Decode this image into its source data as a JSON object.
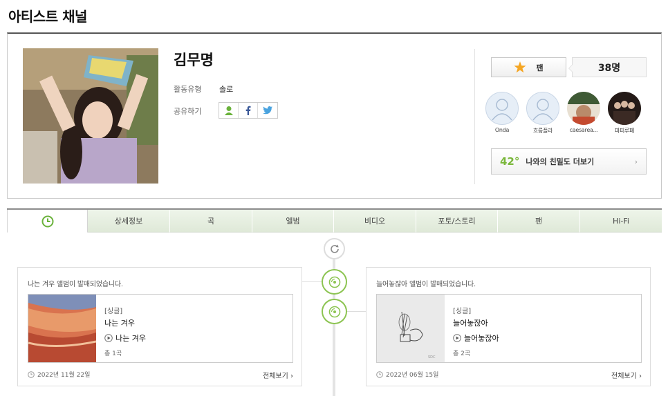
{
  "page": {
    "title": "아티스트 채널"
  },
  "artist": {
    "name": "김무명",
    "activity_type_label": "활동유형",
    "activity_type_value": "솔로",
    "share_label": "공유하기"
  },
  "fan": {
    "button_label": "팬",
    "count": "38명",
    "accent_color": "#f5a623",
    "fans": [
      {
        "name": "Onda",
        "avatar": "default-avatar-icon"
      },
      {
        "name": "흐름플라",
        "avatar": "default-avatar-icon"
      },
      {
        "name": "caesarea...",
        "avatar": "photo"
      },
      {
        "name": "파피루페",
        "avatar": "photo"
      }
    ],
    "intimacy_degree": "42°",
    "intimacy_label": "나와의 친밀도 더보기"
  },
  "tabs": [
    {
      "label": "",
      "icon": "clock-icon",
      "active": true
    },
    {
      "label": "상세정보"
    },
    {
      "label": "곡"
    },
    {
      "label": "앨범"
    },
    {
      "label": "비디오"
    },
    {
      "label": "포토/스토리"
    },
    {
      "label": "팬"
    },
    {
      "label": "Hi-Fi"
    }
  ],
  "timeline": {
    "accent_color": "#8cc451",
    "cards": [
      {
        "headline": "나는 겨우 앨범이 발매되었습니다.",
        "type": "[싱글]",
        "album_title": "나는 겨우",
        "track": "나는 겨우",
        "count": "총 1곡",
        "date": "2022년 11월 22일",
        "more": "전체보기 ›"
      },
      {
        "headline": "늘어놓잖아 앨범이 발매되었습니다.",
        "type": "[싱글]",
        "album_title": "늘어놓잖아",
        "track": "늘어놓잖아",
        "count": "총 2곡",
        "date": "2022년 06월 15일",
        "more": "전체보기 ›"
      }
    ]
  }
}
